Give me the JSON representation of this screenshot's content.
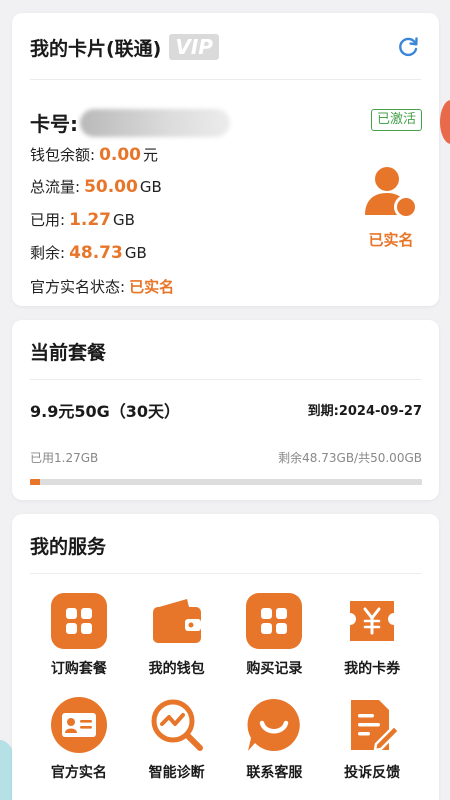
{
  "sim_card": {
    "title": "我的卡片(联通)",
    "vip": "VIP",
    "card_no_label": "卡号:",
    "status_badge": "已激活",
    "wallet_label": "钱包余额:",
    "wallet_value": "0.00",
    "wallet_unit": "元",
    "total_label": "总流量:",
    "total_value": "50.00",
    "total_unit": "GB",
    "used_label": "已用:",
    "used_value": "1.27",
    "used_unit": "GB",
    "remain_label": "剩余:",
    "remain_value": "48.73",
    "remain_unit": "GB",
    "realname_label": "官方实名状态:",
    "realname_value": "已实名",
    "verified_label": "已实名"
  },
  "plan": {
    "title": "当前套餐",
    "name": "9.9元50G（30天）",
    "expiry": "到期:2024-09-27",
    "used_text": "已用1.27GB",
    "remain_text": "剩余48.73GB/共50.00GB",
    "used_fraction": 0.0254
  },
  "services": {
    "title": "我的服务",
    "items": [
      {
        "label": "订购套餐",
        "icon": "grid-apps-icon"
      },
      {
        "label": "我的钱包",
        "icon": "wallet-icon"
      },
      {
        "label": "购买记录",
        "icon": "grid-apps-icon"
      },
      {
        "label": "我的卡券",
        "icon": "yen-ticket-icon"
      },
      {
        "label": "官方实名",
        "icon": "id-card-icon"
      },
      {
        "label": "智能诊断",
        "icon": "diagnosis-icon"
      },
      {
        "label": "联系客服",
        "icon": "smile-chat-icon"
      },
      {
        "label": "投诉反馈",
        "icon": "feedback-edit-icon"
      }
    ]
  },
  "colors": {
    "accent": "#e8762a",
    "success": "#46a24a",
    "refresh": "#3a86d8"
  }
}
